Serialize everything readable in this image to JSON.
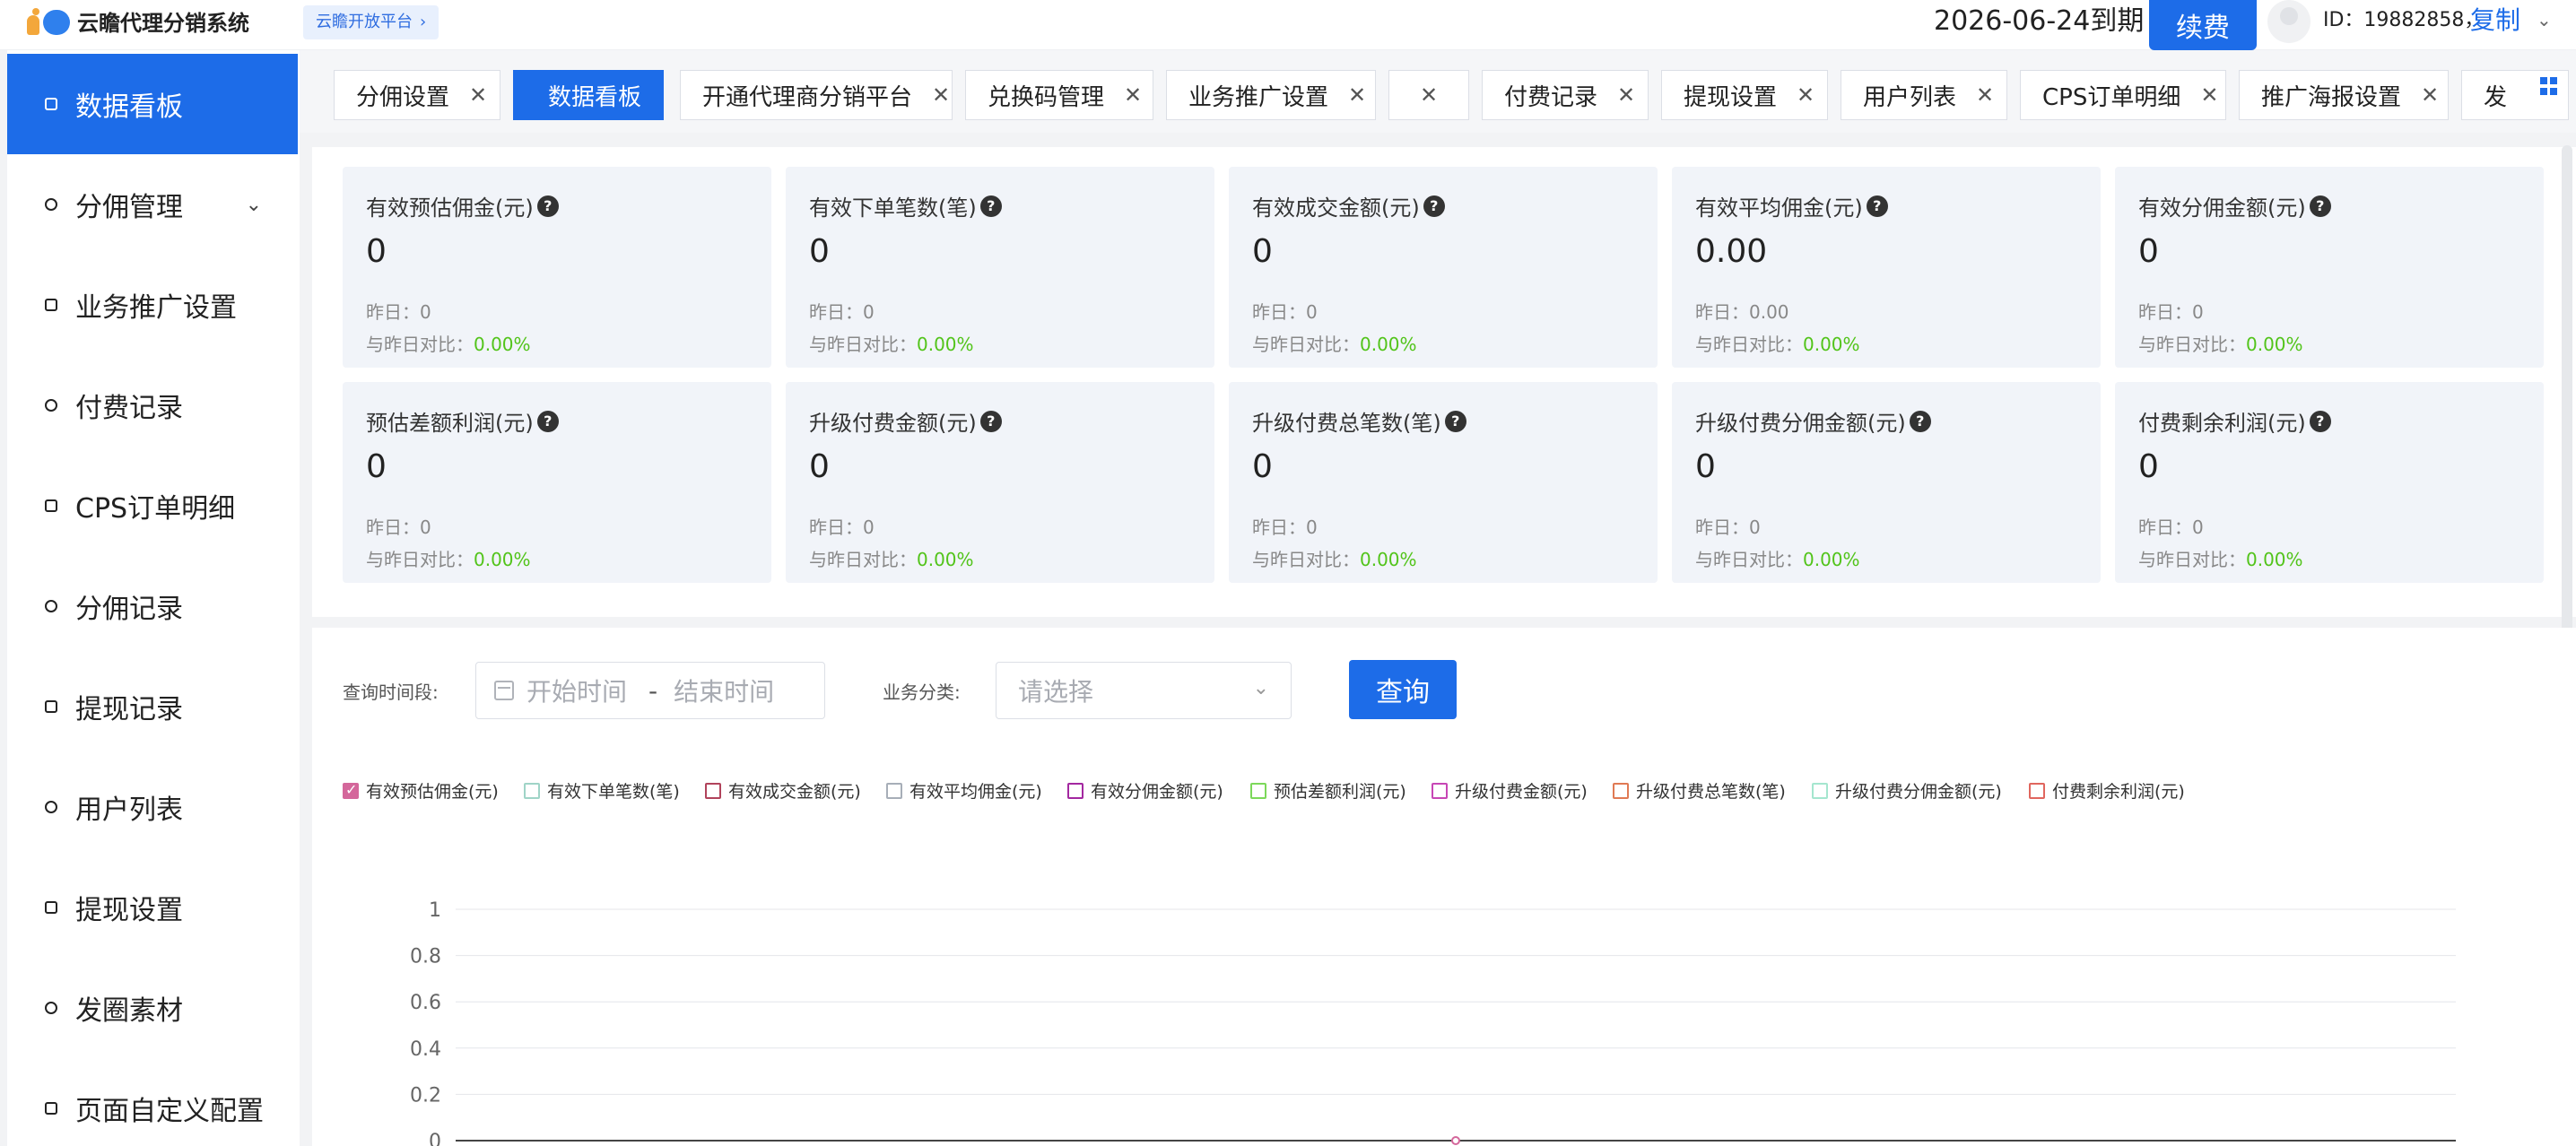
{
  "header": {
    "app_title": "云瞻代理分销系统",
    "open_platform": "云瞻开放平台",
    "expire_text": "2026-06-24到期",
    "renew_label": "续费",
    "user_id": "ID：19882858，",
    "copy_label": "复制"
  },
  "sidebar": {
    "items": [
      {
        "label": "数据看板",
        "icon": "monitor-icon",
        "active": true
      },
      {
        "label": "分佣管理",
        "icon": "user-icon",
        "expandable": true
      },
      {
        "label": "业务推广设置",
        "icon": "briefcase-icon"
      },
      {
        "label": "付费记录",
        "icon": "payment-icon"
      },
      {
        "label": "CPS订单明细",
        "icon": "order-icon"
      },
      {
        "label": "分佣记录",
        "icon": "record-icon"
      },
      {
        "label": "提现记录",
        "icon": "document-icon"
      },
      {
        "label": "用户列表",
        "icon": "users-icon"
      },
      {
        "label": "提现设置",
        "icon": "settings-icon"
      },
      {
        "label": "发圈素材",
        "icon": "material-icon"
      },
      {
        "label": "页面自定义配置",
        "icon": "palette-icon"
      }
    ]
  },
  "tabs": [
    {
      "label": "分佣设置",
      "closable": true
    },
    {
      "label": "数据看板",
      "active": true
    },
    {
      "label": "开通代理商分销平台",
      "closable": true
    },
    {
      "label": "兑换码管理",
      "closable": true
    },
    {
      "label": "业务推广设置",
      "closable": true
    },
    {
      "label": "",
      "closable": true
    },
    {
      "label": "付费记录",
      "closable": true
    },
    {
      "label": "提现设置",
      "closable": true
    },
    {
      "label": "用户列表",
      "closable": true
    },
    {
      "label": "CPS订单明细",
      "closable": true
    },
    {
      "label": "推广海报设置",
      "closable": true
    },
    {
      "label": "发"
    }
  ],
  "stats": {
    "yesterday_prefix": "昨日：",
    "compare_prefix": "与昨日对比：",
    "cards": [
      {
        "title": "有效预估佣金(元)",
        "value": "0",
        "yesterday": "0",
        "compare": "0.00%"
      },
      {
        "title": "有效下单笔数(笔)",
        "value": "0",
        "yesterday": "0",
        "compare": "0.00%"
      },
      {
        "title": "有效成交金额(元)",
        "value": "0",
        "yesterday": "0",
        "compare": "0.00%"
      },
      {
        "title": "有效平均佣金(元)",
        "value": "0.00",
        "yesterday": "0.00",
        "compare": "0.00%"
      },
      {
        "title": "有效分佣金额(元)",
        "value": "0",
        "yesterday": "0",
        "compare": "0.00%"
      },
      {
        "title": "预估差额利润(元)",
        "value": "0",
        "yesterday": "0",
        "compare": "0.00%"
      },
      {
        "title": "升级付费金额(元)",
        "value": "0",
        "yesterday": "0",
        "compare": "0.00%"
      },
      {
        "title": "升级付费总笔数(笔)",
        "value": "0",
        "yesterday": "0",
        "compare": "0.00%"
      },
      {
        "title": "升级付费分佣金额(元)",
        "value": "0",
        "yesterday": "0",
        "compare": "0.00%"
      },
      {
        "title": "付费剩余利润(元)",
        "value": "0",
        "yesterday": "0",
        "compare": "0.00%"
      }
    ]
  },
  "query": {
    "period_label": "查询时间段:",
    "start_placeholder": "开始时间",
    "separator": "-",
    "end_placeholder": "结束时间",
    "category_label": "业务分类:",
    "category_placeholder": "请选择",
    "query_label": "查询"
  },
  "legend": [
    {
      "label": "有效预估佣金(元)",
      "color": "#d4679b",
      "checked": true
    },
    {
      "label": "有效下单笔数(笔)",
      "color": "#9fd4c7",
      "checked": false
    },
    {
      "label": "有效成交金额(元)",
      "color": "#b1435b",
      "checked": false
    },
    {
      "label": "有效平均佣金(元)",
      "color": "#a7aeb8",
      "checked": false
    },
    {
      "label": "有效分佣金额(元)",
      "color": "#a328a0",
      "checked": false
    },
    {
      "label": "预估差额利润(元)",
      "color": "#7cd85a",
      "checked": false
    },
    {
      "label": "升级付费金额(元)",
      "color": "#c746b5",
      "checked": false
    },
    {
      "label": "升级付费总笔数(笔)",
      "color": "#e07a54",
      "checked": false
    },
    {
      "label": "升级付费分佣金额(元)",
      "color": "#a5e6cf",
      "checked": false
    },
    {
      "label": "付费剩余利润(元)",
      "color": "#e0665e",
      "checked": false
    }
  ],
  "chart_data": {
    "type": "line",
    "ylim": [
      0,
      1
    ],
    "yticks": [
      "1",
      "0.8",
      "0.6",
      "0.4",
      "0.2",
      "0"
    ],
    "grid": true,
    "series": [
      {
        "name": "有效预估佣金(元)",
        "color": "#d4679b",
        "values": [
          0
        ]
      }
    ]
  },
  "colors": {
    "accent": "#1d6ce8",
    "positive": "#52c41a",
    "card_bg": "#f1f4f9"
  }
}
